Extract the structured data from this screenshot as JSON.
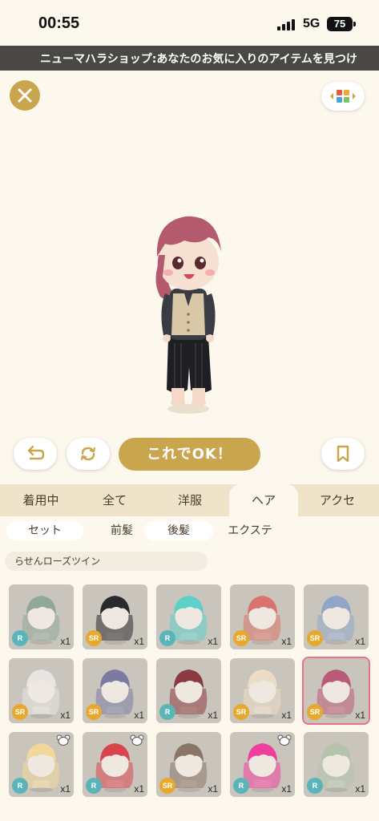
{
  "status_bar": {
    "time": "00:55",
    "network": "5G",
    "battery": "75"
  },
  "marquee": {
    "text": "ニューマハラショップ:あなたのお気に入りのアイテムを見つけ"
  },
  "toolbar": {
    "ok_label": "これでOK！"
  },
  "category_tabs": [
    {
      "label": "着用中",
      "active": false
    },
    {
      "label": "全て",
      "active": false
    },
    {
      "label": "洋服",
      "active": false
    },
    {
      "label": "ヘア",
      "active": true
    },
    {
      "label": "アクセ",
      "active": false
    }
  ],
  "sub_tabs": [
    {
      "label": "セット"
    },
    {
      "label": "前髪"
    },
    {
      "label": "後髪"
    },
    {
      "label": "エクステ"
    }
  ],
  "selected_item_name": "らせんローズツイン",
  "items": [
    {
      "rarity": "R",
      "qty": "x1",
      "hair": "#8fa89a",
      "bear": false
    },
    {
      "rarity": "SR",
      "qty": "x1",
      "hair": "#2a2a2e",
      "bear": false
    },
    {
      "rarity": "R",
      "qty": "x1",
      "hair": "#5fd0c8",
      "bear": false
    },
    {
      "rarity": "SR",
      "qty": "x1",
      "hair": "#d9736c",
      "bear": false
    },
    {
      "rarity": "SR",
      "qty": "x1",
      "hair": "#8fa6c8",
      "bear": false
    },
    {
      "rarity": "SR",
      "qty": "x1",
      "hair": "#e8e6e2",
      "bear": false
    },
    {
      "rarity": "SR",
      "qty": "x1",
      "hair": "#7c7aa0",
      "bear": false
    },
    {
      "rarity": "R",
      "qty": "x1",
      "hair": "#8a3a40",
      "bear": false
    },
    {
      "rarity": "SR",
      "qty": "x1",
      "hair": "#ecdcc6",
      "bear": false
    },
    {
      "rarity": "SR",
      "qty": "x1",
      "hair": "#b85a78",
      "bear": false,
      "selected": true
    },
    {
      "rarity": "R",
      "qty": "x1",
      "hair": "#f1d89a",
      "bear": true
    },
    {
      "rarity": "R",
      "qty": "x1",
      "hair": "#d8454d",
      "bear": true
    },
    {
      "rarity": "SR",
      "qty": "x1",
      "hair": "#8b7468",
      "bear": false
    },
    {
      "rarity": "R",
      "qty": "x1",
      "hair": "#ee3f9e",
      "bear": true
    },
    {
      "rarity": "R",
      "qty": "x1",
      "hair": "#b5c3ad",
      "bear": false
    }
  ],
  "colors": {
    "accent": "#c9a54e",
    "background": "#fdf8ee",
    "tab_bar": "#efe3c9",
    "selected_outline": "#e8708a"
  },
  "icons": [
    "close-icon",
    "wardrobe-icon",
    "undo-icon",
    "shuffle-icon",
    "bookmark-icon",
    "bear-icon"
  ]
}
